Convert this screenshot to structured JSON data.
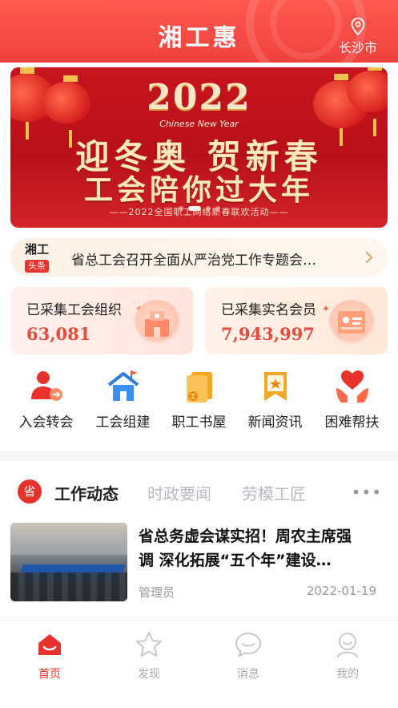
{
  "header": {
    "title": "湘工惠",
    "city": "长沙市"
  },
  "banner": {
    "year": "2022",
    "subtitle_en": "Chinese New Year",
    "line1": "迎冬奥 贺新春",
    "line2": "工会陪你过大年",
    "caption": "——2022全国职工网络新春联欢活动——",
    "active_slide": 1,
    "slide_count": 4
  },
  "ticker": {
    "badge_top": "湘工",
    "badge_bottom": "头条",
    "text": "省总工会召开全面从严治党工作专题会…"
  },
  "stats": [
    {
      "label": "已采集工会组织",
      "value": "63,081"
    },
    {
      "label": "已采集实名会员",
      "value": "7,943,997"
    }
  ],
  "quick_nav": [
    {
      "label": "入会转会",
      "icon": "person-transfer-icon"
    },
    {
      "label": "工会组建",
      "icon": "house-flag-icon"
    },
    {
      "label": "职工书屋",
      "icon": "book-icon"
    },
    {
      "label": "新闻资讯",
      "icon": "news-bookmark-icon"
    },
    {
      "label": "困难帮扶",
      "icon": "heart-hands-icon"
    }
  ],
  "news_tabs": {
    "seal": "省",
    "tabs": [
      "工作动态",
      "时政要闻",
      "劳模工匠"
    ],
    "active": 0
  },
  "news_item": {
    "title_line1": "省总务虚会谋实招！周农主席强",
    "title_line2": "调 深化拓展“五个年”建设…",
    "author": "管理员",
    "date": "2022-01-19"
  },
  "bottom_tabs": [
    {
      "label": "首页",
      "icon": "home-icon",
      "active": true
    },
    {
      "label": "发现",
      "icon": "star-icon",
      "active": false
    },
    {
      "label": "消息",
      "icon": "message-icon",
      "active": false
    },
    {
      "label": "我的",
      "icon": "profile-icon",
      "active": false
    }
  ],
  "colors": {
    "brand_red": "#e8332d",
    "header_red": "#f0413d",
    "stat_value": "#e94a3a",
    "muted": "#b9b9c0"
  }
}
